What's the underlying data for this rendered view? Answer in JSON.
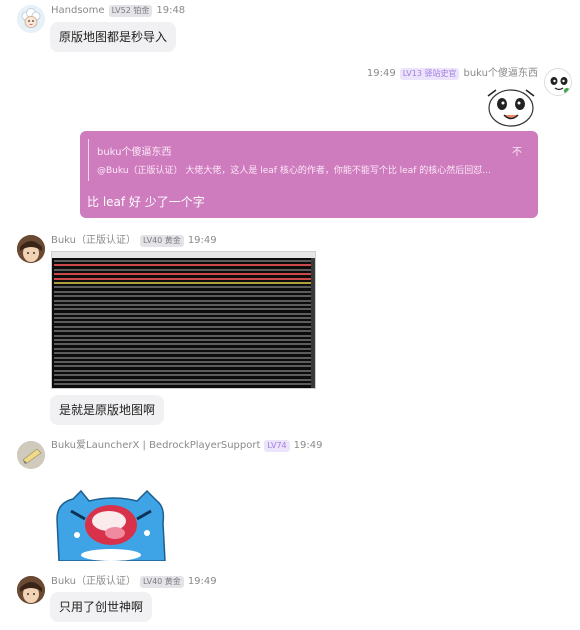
{
  "messages": [
    {
      "user": "Handsome",
      "badge": "LV52 铂金",
      "time": "19:48",
      "text": "原版地图都是秒导入"
    },
    {
      "user": "buku个傻逼东西",
      "badge": "LV13 驿站史官",
      "time": "19:49"
    },
    {
      "reply_to": "buku个傻逼东西",
      "reply_close": "不",
      "quoted": "@Buku（正版认证） 大佬大佬，这人是 leaf 核心的作者，你能不能写个比 leaf 的核心然后回怼...",
      "text": "比 leaf 好 少了一个字"
    },
    {
      "user": "Buku（正版认证）",
      "badge": "LV40 黄金",
      "time": "19:49",
      "text": "是就是原版地图啊"
    },
    {
      "user": "Buku爱LauncherX | BedrockPlayerSupport",
      "badge": "LV74",
      "time": "19:49"
    },
    {
      "user": "Buku（正版认证）",
      "badge": "LV40 黄金",
      "time": "19:49",
      "text": "只用了创世神啊"
    }
  ],
  "colors": {
    "reply_card": "#cf7cbf",
    "bubble": "#f1f1f3",
    "badge_purple": "#ece4fb",
    "badge_gray": "#e4e4e8"
  },
  "icons": {
    "avatar_handsome": "sheep-avatar-icon",
    "sticker_1": "panda-meme-sticker",
    "avatar_buku": "anime-avatar-icon",
    "avatar_launcherx": "envelope-avatar-icon",
    "sticker_2": "blue-cat-sticker"
  }
}
